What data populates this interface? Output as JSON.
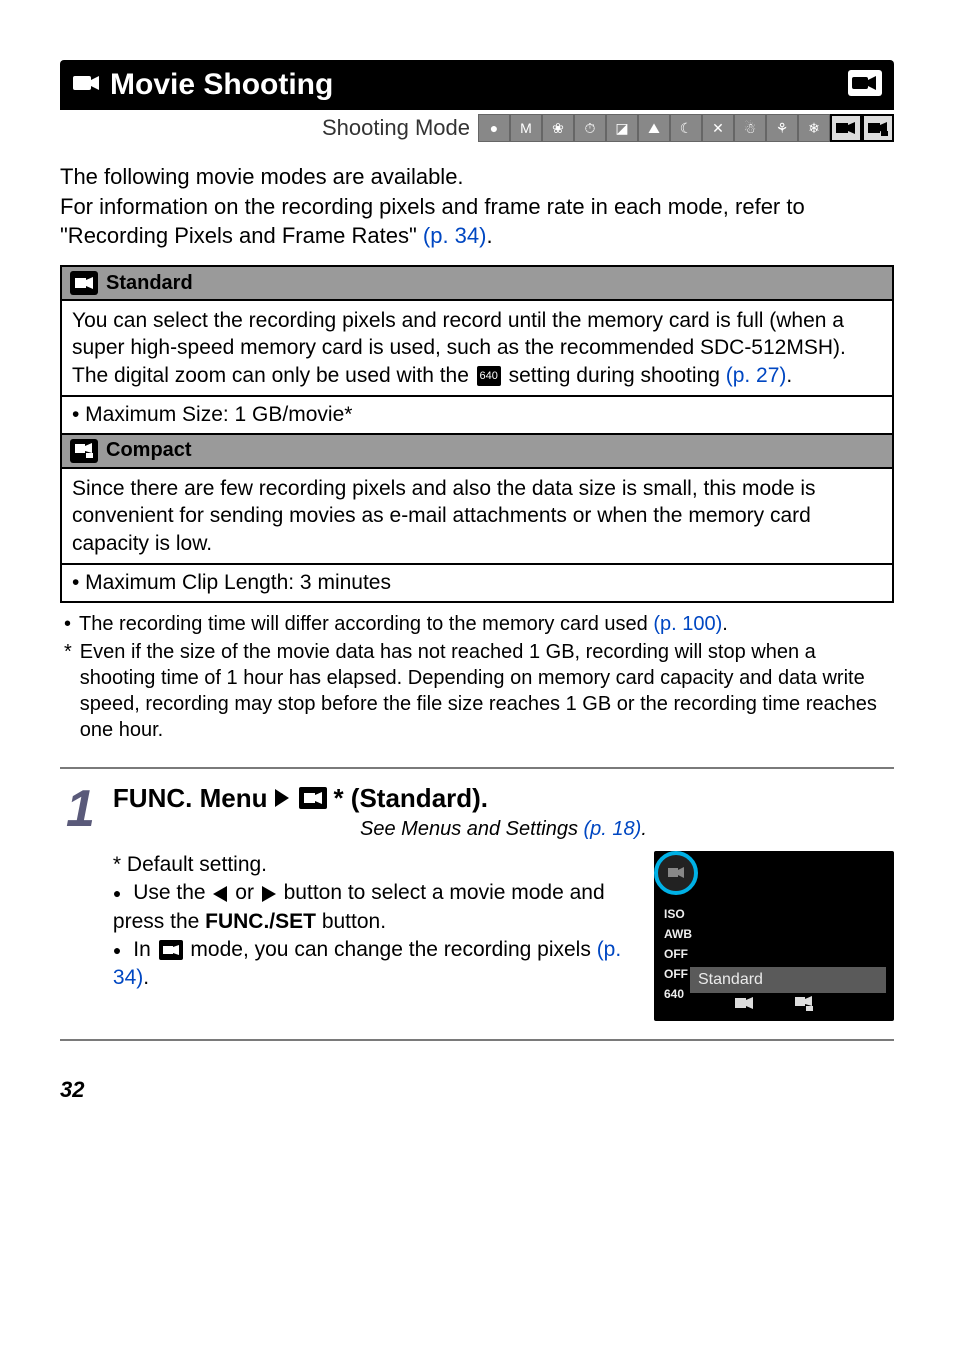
{
  "title": "Movie Shooting",
  "shooting_mode_label": "Shooting Mode",
  "intro_text_a": "The following movie modes are available.",
  "intro_text_b": "For information on the recording pixels and frame rate in each mode, refer to \"Recording Pixels and Frame Rates\" ",
  "intro_link": "(p. 34)",
  "intro_period": ".",
  "standard": {
    "heading": "Standard",
    "desc_a": "You can select the recording pixels and record until the memory card is full (when a super high-speed memory card is used, such as the recommended SDC-512MSH).",
    "desc_b_pre": "The digital zoom can only be used with the ",
    "desc_b_post": " setting during shooting ",
    "desc_b_link": "(p. 27)",
    "desc_b_period": ".",
    "spec": "• Maximum Size: 1 GB/movie*"
  },
  "compact": {
    "heading": "Compact",
    "desc": "Since there are few recording pixels and also the data size is small, this mode is convenient for sending movies as e-mail attachments or when the memory card capacity is low.",
    "spec": "• Maximum Clip Length: 3 minutes"
  },
  "note1_bullet": "•",
  "note1_text": "The recording time will differ according to the memory card used ",
  "note1_link": "(p. 100)",
  "note1_period": ".",
  "note2_bullet": "*",
  "note2_text": "Even if the size of the movie data has not reached 1 GB, recording will stop when a shooting time of 1 hour has elapsed. Depending on memory card capacity and data write speed, recording may stop before the file size reaches 1 GB or the recording time reaches one hour.",
  "step": {
    "num": "1",
    "heading_a": "FUNC. Menu",
    "heading_b": "* (Standard).",
    "sub_pre": "See Menus and Settings ",
    "sub_link": "(p. 18)",
    "sub_period": ".",
    "default": " * Default setting.",
    "b1_pre": "Use the ",
    "b1_mid": " or ",
    "b1_post": " button to select a movie mode and press the ",
    "b1_bold": "FUNC./SET",
    "b1_end": " button.",
    "b2_pre": "In ",
    "b2_post": " mode, you can change the recording pixels ",
    "b2_link": "(p. 34)",
    "b2_period": "."
  },
  "lcd": {
    "iso": "ISO",
    "awb": "AWB",
    "off1": "OFF",
    "off2": "OFF",
    "res": "640",
    "label": "Standard"
  },
  "page_number": "32"
}
